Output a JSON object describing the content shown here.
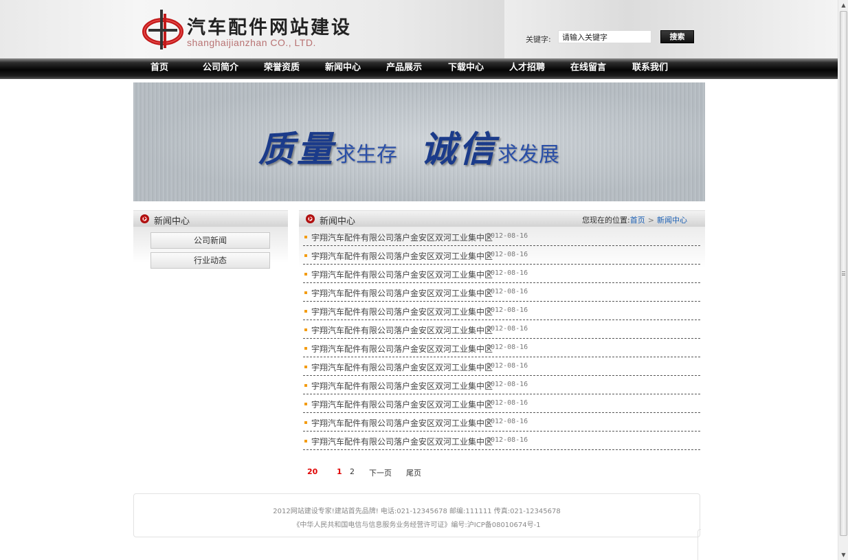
{
  "header": {
    "logo_title": "汽车配件网站建设",
    "logo_subtitle": "shanghaijianzhan CO., LTD.",
    "search_label": "关键字:",
    "search_value": "请输入关键字",
    "search_button": "搜索"
  },
  "nav": {
    "items": [
      "首页",
      "公司简介",
      "荣誉资质",
      "新闻中心",
      "产品展示",
      "下载中心",
      "人才招聘",
      "在线留言",
      "联系我们"
    ]
  },
  "banner": {
    "part1_big": "质量",
    "part1_small": "求生存",
    "part2_big": "诚信",
    "part2_small": "求发展"
  },
  "sidebar": {
    "title": "新闻中心",
    "items": [
      "公司新闻",
      "行业动态"
    ]
  },
  "main": {
    "title": "新闻中心",
    "breadcrumb_prefix": "您现在的位置:",
    "breadcrumb_home": "首页",
    "breadcrumb_sep": ">",
    "breadcrumb_current": "新闻中心",
    "news": [
      {
        "title": "宇翔汽车配件有限公司落户金安区双河工业集中区",
        "date": "2012-08-16"
      },
      {
        "title": "宇翔汽车配件有限公司落户金安区双河工业集中区",
        "date": "2012-08-16"
      },
      {
        "title": "宇翔汽车配件有限公司落户金安区双河工业集中区",
        "date": "2012-08-16"
      },
      {
        "title": "宇翔汽车配件有限公司落户金安区双河工业集中区",
        "date": "2012-08-16"
      },
      {
        "title": "宇翔汽车配件有限公司落户金安区双河工业集中区",
        "date": "2012-08-16"
      },
      {
        "title": "宇翔汽车配件有限公司落户金安区双河工业集中区",
        "date": "2012-08-16"
      },
      {
        "title": "宇翔汽车配件有限公司落户金安区双河工业集中区",
        "date": "2012-08-16"
      },
      {
        "title": "宇翔汽车配件有限公司落户金安区双河工业集中区",
        "date": "2012-08-16"
      },
      {
        "title": "宇翔汽车配件有限公司落户金安区双河工业集中区",
        "date": "2012-08-16"
      },
      {
        "title": "宇翔汽车配件有限公司落户金安区双河工业集中区",
        "date": "2012-08-16"
      },
      {
        "title": "宇翔汽车配件有限公司落户金安区双河工业集中区",
        "date": "2012-08-16"
      },
      {
        "title": "宇翔汽车配件有限公司落户金安区双河工业集中区",
        "date": "2012-08-16"
      }
    ],
    "pagination": {
      "total": "20",
      "current": "1",
      "page2": "2",
      "next": "下一页",
      "last": "尾页"
    }
  },
  "footer": {
    "line1": "2012网站建设专家!建站首先品牌!    电话:021-12345678   邮编:111111   传真:021-12345678",
    "line2": "《中华人民共和国电信与信息服务业务经营许可证》编号:沪ICP备08010674号-1"
  },
  "colors": {
    "accent_red": "#e00000",
    "link_blue": "#1a5fb4",
    "bullet_orange": "#f39c12",
    "nav_bg": "#050505"
  }
}
